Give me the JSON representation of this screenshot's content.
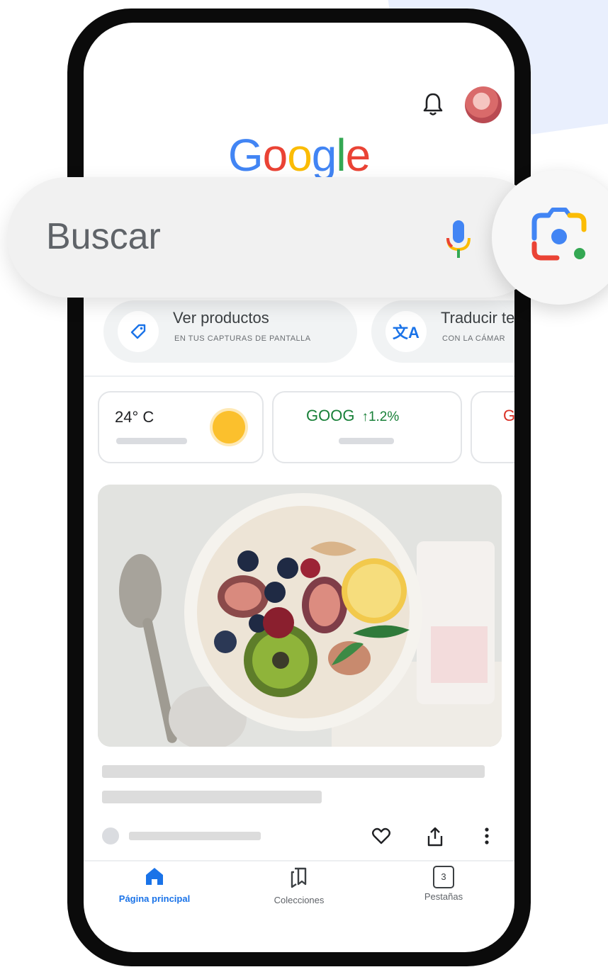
{
  "header": {
    "logo": "Google",
    "bell_icon": "bell-icon",
    "avatar": "profile-avatar"
  },
  "search": {
    "placeholder": "Buscar",
    "mic_icon": "mic-icon",
    "lens_icon": "google-lens-icon"
  },
  "chips": [
    {
      "icon": "tag-icon",
      "title": "Ver productos",
      "subtitle": "EN TUS CAPTURAS DE PANTALLA"
    },
    {
      "icon": "translate-icon",
      "title": "Traducir te",
      "subtitle": "CON LA CÁMAR"
    }
  ],
  "cards": {
    "weather": {
      "temp": "24° C"
    },
    "stock": {
      "ticker": "GOOG",
      "change": "↑1.2%"
    },
    "third": {
      "text": "G"
    }
  },
  "feed": {
    "image": "fruit-bowl-photo"
  },
  "actions": {
    "like_icon": "heart-icon",
    "share_icon": "share-icon",
    "more_icon": "more-vert-icon"
  },
  "nav": [
    {
      "label": "Página principal",
      "icon": "home-icon",
      "active": true
    },
    {
      "label": "Colecciones",
      "icon": "collections-icon"
    },
    {
      "label": "Pestañas",
      "icon": "tabs-icon",
      "count": "3"
    }
  ],
  "colors": {
    "google_blue": "#4285F4",
    "google_red": "#EA4335",
    "google_yellow": "#FBBC05",
    "google_green": "#34A853",
    "stock_green": "#188038",
    "active_nav": "#1a73e8"
  }
}
